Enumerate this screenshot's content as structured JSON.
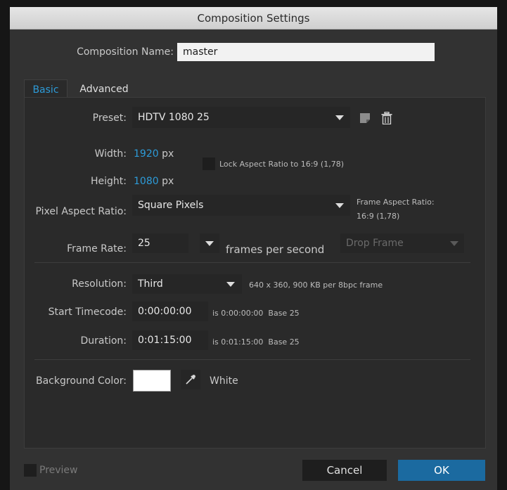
{
  "dialog": {
    "title": "Composition Settings"
  },
  "composition": {
    "name_label": "Composition Name:",
    "name_value": "master"
  },
  "tabs": [
    {
      "label": "Basic"
    },
    {
      "label": "Advanced"
    }
  ],
  "preset": {
    "label": "Preset:",
    "value": "HDTV 1080 25"
  },
  "width": {
    "label": "Width:",
    "value": "1920",
    "unit": "px"
  },
  "height": {
    "label": "Height:",
    "value": "1080",
    "unit": "px"
  },
  "lock_aspect": {
    "label": "Lock Aspect Ratio to 16:9 (1,78)",
    "checked": false
  },
  "pixel_aspect": {
    "label": "Pixel Aspect Ratio:",
    "value": "Square Pixels"
  },
  "frame_aspect": {
    "label": "Frame Aspect Ratio:",
    "value": "16:9 (1,78)"
  },
  "frame_rate": {
    "label": "Frame Rate:",
    "value": "25",
    "unit": "frames per second",
    "drop_frame": "Drop Frame"
  },
  "resolution": {
    "label": "Resolution:",
    "value": "Third",
    "info": "640 x 360, 900 KB per 8bpc frame"
  },
  "start_timecode": {
    "label": "Start Timecode:",
    "value": "0:00:00:00",
    "info_prefix": "is 0:00:00:00",
    "info_base": "Base 25"
  },
  "duration": {
    "label": "Duration:",
    "value": "0:01:15:00",
    "info_prefix": "is 0:01:15:00",
    "info_base": "Base 25"
  },
  "background": {
    "label": "Background Color:",
    "color": "#ffffff",
    "color_name": "White"
  },
  "footer": {
    "preview_label": "Preview",
    "cancel_label": "Cancel",
    "ok_label": "OK"
  },
  "colors": {
    "accent": "#2d9bd8",
    "dialog_bg": "#323232",
    "panel_bg": "#2a2a2a",
    "field_bg": "#262626",
    "ok_button": "#1b6aa0"
  },
  "icons": {
    "preset_save": "save-preset-icon",
    "preset_delete": "trash-icon",
    "eyedropper": "eyedropper-icon",
    "dropdown": "chevron-down-icon"
  }
}
